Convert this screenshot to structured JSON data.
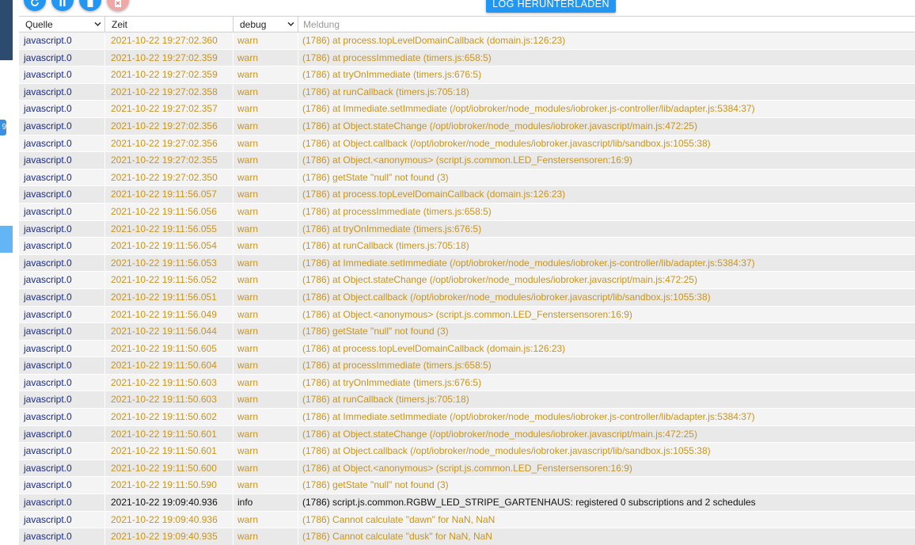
{
  "toolbar": {
    "buttons": [
      {
        "name": "refresh",
        "icon": "refresh-icon"
      },
      {
        "name": "pause",
        "icon": "pause-icon"
      },
      {
        "name": "clear",
        "icon": "trash-icon"
      },
      {
        "name": "delete-logs",
        "icon": "delete-file-icon"
      }
    ],
    "download_label": "LOG HERUNTERLADEN"
  },
  "sidebar": {
    "badge_text": "9"
  },
  "table": {
    "headers": {
      "source": "Quelle",
      "time": "Zeit",
      "level": "debug",
      "message": "Meldung"
    },
    "rows": [
      {
        "source": "javascript.0",
        "time": "2021-10-22 19:27:02.360",
        "level": "warn",
        "message": "(1786) at process.topLevelDomainCallback (domain.js:126:23)"
      },
      {
        "source": "javascript.0",
        "time": "2021-10-22 19:27:02.359",
        "level": "warn",
        "message": "(1786) at processImmediate (timers.js:658:5)"
      },
      {
        "source": "javascript.0",
        "time": "2021-10-22 19:27:02.359",
        "level": "warn",
        "message": "(1786) at tryOnImmediate (timers.js:676:5)"
      },
      {
        "source": "javascript.0",
        "time": "2021-10-22 19:27:02.358",
        "level": "warn",
        "message": "(1786) at runCallback (timers.js:705:18)"
      },
      {
        "source": "javascript.0",
        "time": "2021-10-22 19:27:02.357",
        "level": "warn",
        "message": "(1786) at Immediate.setImmediate (/opt/iobroker/node_modules/iobroker.js-controller/lib/adapter.js:5384:37)"
      },
      {
        "source": "javascript.0",
        "time": "2021-10-22 19:27:02.356",
        "level": "warn",
        "message": "(1786) at Object.stateChange (/opt/iobroker/node_modules/iobroker.javascript/main.js:472:25)"
      },
      {
        "source": "javascript.0",
        "time": "2021-10-22 19:27:02.356",
        "level": "warn",
        "message": "(1786) at Object.callback (/opt/iobroker/node_modules/iobroker.javascript/lib/sandbox.js:1055:38)"
      },
      {
        "source": "javascript.0",
        "time": "2021-10-22 19:27:02.355",
        "level": "warn",
        "message": "(1786) at Object.<anonymous> (script.js.common.LED_Fenstersensoren:16:9)"
      },
      {
        "source": "javascript.0",
        "time": "2021-10-22 19:27:02.350",
        "level": "warn",
        "message": "(1786) getState \"null\" not found (3)"
      },
      {
        "source": "javascript.0",
        "time": "2021-10-22 19:11:56.057",
        "level": "warn",
        "message": "(1786) at process.topLevelDomainCallback (domain.js:126:23)"
      },
      {
        "source": "javascript.0",
        "time": "2021-10-22 19:11:56.056",
        "level": "warn",
        "message": "(1786) at processImmediate (timers.js:658:5)"
      },
      {
        "source": "javascript.0",
        "time": "2021-10-22 19:11:56.055",
        "level": "warn",
        "message": "(1786) at tryOnImmediate (timers.js:676:5)"
      },
      {
        "source": "javascript.0",
        "time": "2021-10-22 19:11:56.054",
        "level": "warn",
        "message": "(1786) at runCallback (timers.js:705:18)"
      },
      {
        "source": "javascript.0",
        "time": "2021-10-22 19:11:56.053",
        "level": "warn",
        "message": "(1786) at Immediate.setImmediate (/opt/iobroker/node_modules/iobroker.js-controller/lib/adapter.js:5384:37)"
      },
      {
        "source": "javascript.0",
        "time": "2021-10-22 19:11:56.052",
        "level": "warn",
        "message": "(1786) at Object.stateChange (/opt/iobroker/node_modules/iobroker.javascript/main.js:472:25)"
      },
      {
        "source": "javascript.0",
        "time": "2021-10-22 19:11:56.051",
        "level": "warn",
        "message": "(1786) at Object.callback (/opt/iobroker/node_modules/iobroker.javascript/lib/sandbox.js:1055:38)"
      },
      {
        "source": "javascript.0",
        "time": "2021-10-22 19:11:56.049",
        "level": "warn",
        "message": "(1786) at Object.<anonymous> (script.js.common.LED_Fenstersensoren:16:9)"
      },
      {
        "source": "javascript.0",
        "time": "2021-10-22 19:11:56.044",
        "level": "warn",
        "message": "(1786) getState \"null\" not found (3)"
      },
      {
        "source": "javascript.0",
        "time": "2021-10-22 19:11:50.605",
        "level": "warn",
        "message": "(1786) at process.topLevelDomainCallback (domain.js:126:23)"
      },
      {
        "source": "javascript.0",
        "time": "2021-10-22 19:11:50.604",
        "level": "warn",
        "message": "(1786) at processImmediate (timers.js:658:5)"
      },
      {
        "source": "javascript.0",
        "time": "2021-10-22 19:11:50.603",
        "level": "warn",
        "message": "(1786) at tryOnImmediate (timers.js:676:5)"
      },
      {
        "source": "javascript.0",
        "time": "2021-10-22 19:11:50.603",
        "level": "warn",
        "message": "(1786) at runCallback (timers.js:705:18)"
      },
      {
        "source": "javascript.0",
        "time": "2021-10-22 19:11:50.602",
        "level": "warn",
        "message": "(1786) at Immediate.setImmediate (/opt/iobroker/node_modules/iobroker.js-controller/lib/adapter.js:5384:37)"
      },
      {
        "source": "javascript.0",
        "time": "2021-10-22 19:11:50.601",
        "level": "warn",
        "message": "(1786) at Object.stateChange (/opt/iobroker/node_modules/iobroker.javascript/main.js:472:25)"
      },
      {
        "source": "javascript.0",
        "time": "2021-10-22 19:11:50.601",
        "level": "warn",
        "message": "(1786) at Object.callback (/opt/iobroker/node_modules/iobroker.javascript/lib/sandbox.js:1055:38)"
      },
      {
        "source": "javascript.0",
        "time": "2021-10-22 19:11:50.600",
        "level": "warn",
        "message": "(1786) at Object.<anonymous> (script.js.common.LED_Fenstersensoren:16:9)"
      },
      {
        "source": "javascript.0",
        "time": "2021-10-22 19:11:50.590",
        "level": "warn",
        "message": "(1786) getState \"null\" not found (3)"
      },
      {
        "source": "javascript.0",
        "time": "2021-10-22 19:09:40.936",
        "level": "info",
        "message": "(1786) script.js.common.RGBW_LED_STRIPE_GARTENHAUS: registered 0 subscriptions and 2 schedules"
      },
      {
        "source": "javascript.0",
        "time": "2021-10-22 19:09:40.936",
        "level": "warn",
        "message": "(1786) Cannot calculate \"dawn\" for NaN, NaN"
      },
      {
        "source": "javascript.0",
        "time": "2021-10-22 19:09:40.935",
        "level": "warn",
        "message": "(1786) Cannot calculate \"dusk\" for NaN, NaN"
      }
    ]
  },
  "colors": {
    "accent": "#2196f3",
    "warn_text": "#c9941c",
    "source_text": "#1a2b8c",
    "info_text": "#111111"
  }
}
